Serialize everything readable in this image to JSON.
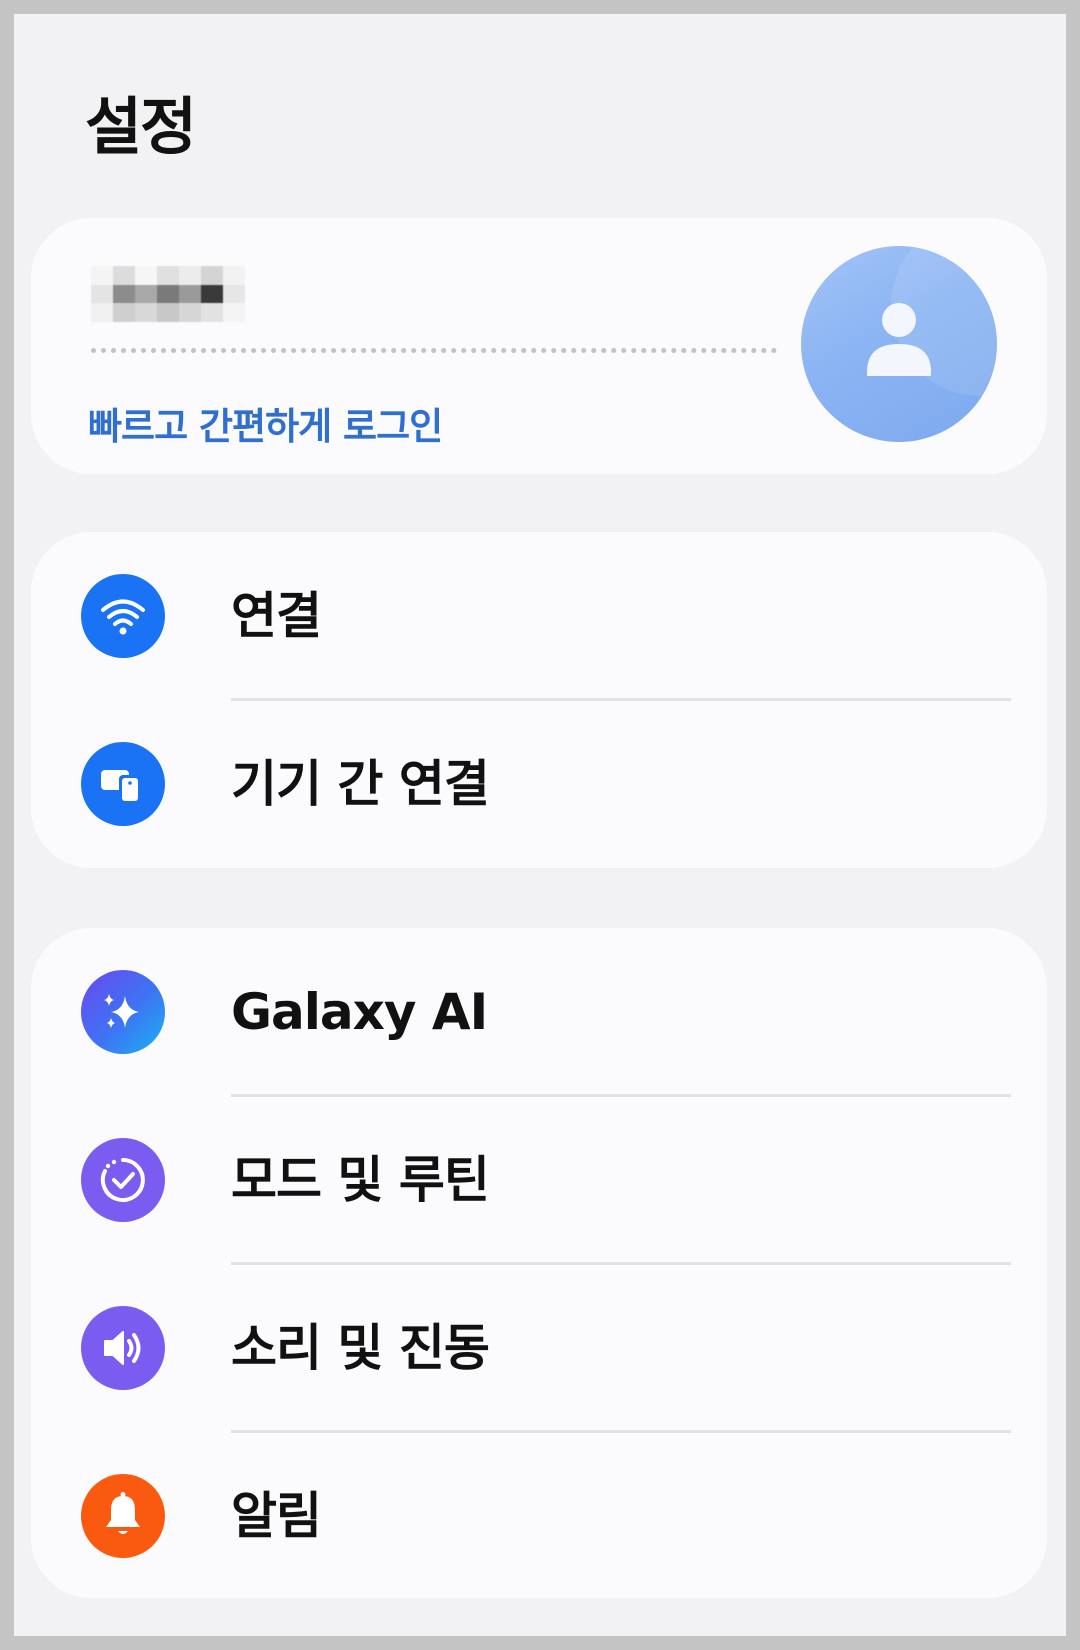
{
  "header": {
    "title": "설정"
  },
  "account": {
    "link_text": "빠르고 간편하게 로그인",
    "avatar_icon": "person-icon",
    "avatar_color": "#8ab4f3"
  },
  "connections_group": {
    "items": [
      {
        "label": "연결",
        "icon": "wifi-icon",
        "color": "#1a73f4"
      },
      {
        "label": "기기 간 연결",
        "icon": "devices-icon",
        "color": "#1a73f4"
      }
    ]
  },
  "features_group": {
    "items": [
      {
        "label": "Galaxy AI",
        "icon": "sparkle-icon",
        "color": "#4f5ef2"
      },
      {
        "label": "모드 및 루틴",
        "icon": "routine-check-icon",
        "color": "#7a5cf0"
      },
      {
        "label": "소리 및 진동",
        "icon": "speaker-icon",
        "color": "#7a5cf0"
      },
      {
        "label": "알림",
        "icon": "bell-icon",
        "color": "#fa5a0f"
      }
    ]
  }
}
